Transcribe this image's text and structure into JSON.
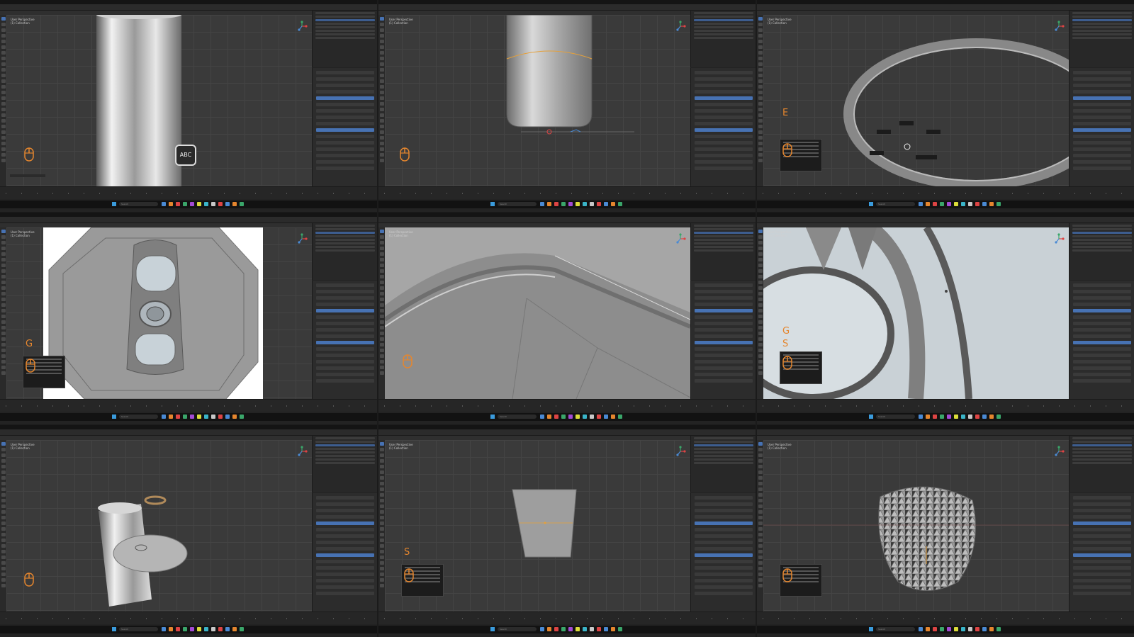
{
  "app": {
    "name": "Blender"
  },
  "labels": {
    "vp_mode": "User Perspective",
    "vp_collection": "(1) Collection",
    "menu": [
      "File",
      "Edit",
      "Render",
      "Window",
      "Help",
      "Layout",
      "Modeling",
      "Sculpting",
      "UV Editing"
    ],
    "taskbar_search": "Search",
    "abc_badge": "ABC"
  },
  "panels": [
    {
      "id": "p1",
      "key": ""
    },
    {
      "id": "p2",
      "key": ""
    },
    {
      "id": "p3",
      "key": "E"
    },
    {
      "id": "p4",
      "key": "G"
    },
    {
      "id": "p5",
      "key": ""
    },
    {
      "id": "p6",
      "key": "G"
    },
    {
      "id": "p7",
      "key": ""
    },
    {
      "id": "p8",
      "key": "S"
    },
    {
      "id": "p9",
      "key": ""
    }
  ],
  "colors": {
    "accent": "#4772b3",
    "key_hint": "#e5862e",
    "bg": "#232323"
  }
}
